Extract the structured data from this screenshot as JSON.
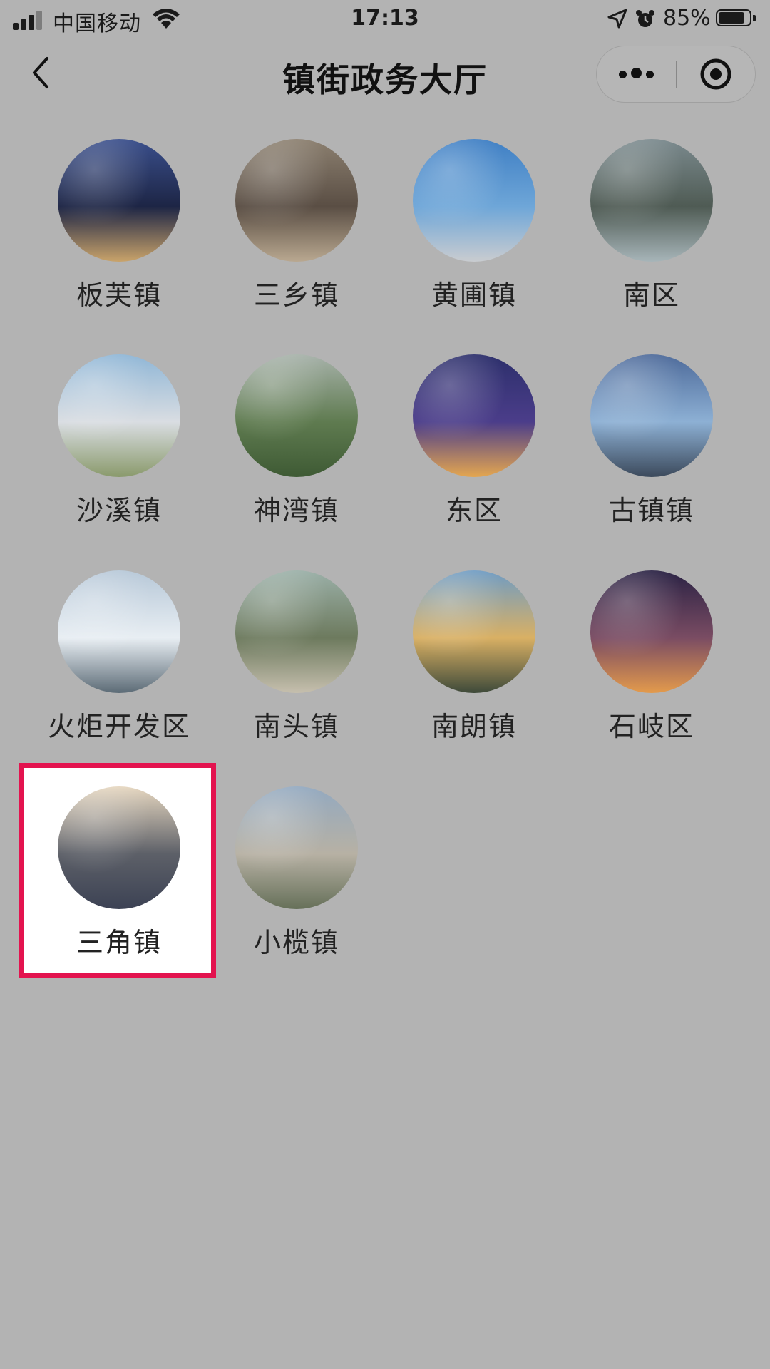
{
  "status_bar": {
    "carrier": "中国移动",
    "time": "17:13",
    "battery_percent_text": "85%",
    "battery_level": 0.85,
    "icons": [
      "signal-icon",
      "wifi-icon",
      "location-arrow-icon",
      "alarm-icon",
      "battery-icon"
    ]
  },
  "nav": {
    "title": "镇街政务大厅",
    "back_icon": "chevron-left-icon",
    "more_icon": "more-dots-icon",
    "close_icon": "target-close-icon"
  },
  "accent_color": "#e3134f",
  "towns": [
    {
      "name": "板芙镇",
      "image": "city-night-aerial",
      "colors": [
        "#3a4f8c",
        "#1d2545",
        "#c9a36a"
      ]
    },
    {
      "name": "三乡镇",
      "image": "residential-aerial",
      "colors": [
        "#8c8070",
        "#5a4e44",
        "#b9a890"
      ]
    },
    {
      "name": "黄圃镇",
      "image": "blue-sky-industrial",
      "colors": [
        "#3f7fc4",
        "#6ea6d8",
        "#c9ccd0"
      ]
    },
    {
      "name": "南区",
      "image": "lake-park-aerial",
      "colors": [
        "#7b8a8e",
        "#4f5b54",
        "#a7b5b9"
      ]
    },
    {
      "name": "沙溪镇",
      "image": "town-cloudy-sky",
      "colors": [
        "#8fb6d6",
        "#d9dde2",
        "#8a9a6c"
      ]
    },
    {
      "name": "神湾镇",
      "image": "green-hills",
      "colors": [
        "#a7b2aa",
        "#5f7b50",
        "#3e5a34"
      ]
    },
    {
      "name": "东区",
      "image": "city-night-towers",
      "colors": [
        "#2c2f6b",
        "#4b3d8a",
        "#e4a650"
      ]
    },
    {
      "name": "古镇镇",
      "image": "twin-towers",
      "colors": [
        "#4d6a9a",
        "#8db0d4",
        "#3c4a5c"
      ]
    },
    {
      "name": "火炬开发区",
      "image": "modern-buildings",
      "colors": [
        "#b7c8d8",
        "#e8eef3",
        "#5c6b76"
      ]
    },
    {
      "name": "南头镇",
      "image": "river-town-aerial",
      "colors": [
        "#9bb0a8",
        "#6d7a5e",
        "#c6bfae"
      ]
    },
    {
      "name": "南朗镇",
      "image": "sunset-wetland",
      "colors": [
        "#6f9cc4",
        "#d9b064",
        "#3e4a3a"
      ]
    },
    {
      "name": "石岐区",
      "image": "ferris-wheel-night",
      "colors": [
        "#2a2244",
        "#7a4c63",
        "#e39a4c"
      ]
    },
    {
      "name": "三角镇",
      "image": "sunrise-city",
      "colors": [
        "#e6d7c0",
        "#5d6068",
        "#3c4254"
      ],
      "selected": true
    },
    {
      "name": "小榄镇",
      "image": "city-highrise",
      "colors": [
        "#93a9c0",
        "#b7b1a4",
        "#667059"
      ]
    }
  ]
}
